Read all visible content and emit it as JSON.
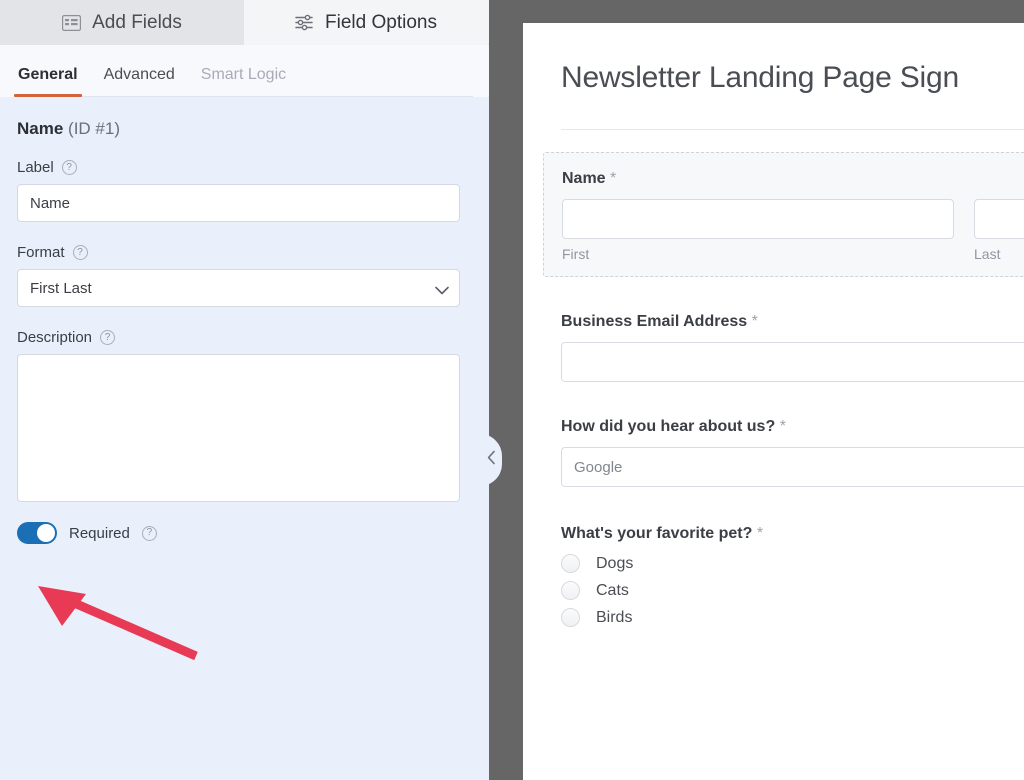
{
  "builder": {
    "primary_tabs": [
      {
        "label": "Add Fields",
        "icon": "list-fields-icon",
        "active": false
      },
      {
        "label": "Field Options",
        "icon": "sliders-icon",
        "active": true
      }
    ],
    "secondary_tabs": [
      {
        "label": "General",
        "state": "active"
      },
      {
        "label": "Advanced",
        "state": "normal"
      },
      {
        "label": "Smart Logic",
        "state": "disabled"
      }
    ],
    "field_heading": {
      "name": "Name",
      "id_text": "(ID #1)"
    },
    "options": {
      "label_label": "Label",
      "label_value": "Name",
      "format_label": "Format",
      "format_value": "First Last",
      "description_label": "Description",
      "description_value": "",
      "required_label": "Required",
      "required_on": true,
      "help_icon": "?"
    },
    "collapse_handle": {
      "icon": "chevron-left-icon"
    },
    "accent_color": "#d4633c",
    "toggle_on_color": "#1a6fb5"
  },
  "preview": {
    "form_title": "Newsletter Landing Page Sign",
    "fields": [
      {
        "label": "Name",
        "required_mark": "*",
        "type": "name",
        "selected": true,
        "sub": [
          {
            "value": "",
            "caption": "First"
          },
          {
            "value": "",
            "caption": "Last"
          }
        ]
      },
      {
        "label": "Business Email Address",
        "required_mark": "*",
        "type": "text",
        "value": ""
      },
      {
        "label": "How did you hear about us?",
        "required_mark": "*",
        "type": "select",
        "value": "Google"
      },
      {
        "label": "What's your favorite pet?",
        "required_mark": "*",
        "type": "radio",
        "choices": [
          "Dogs",
          "Cats",
          "Birds"
        ]
      }
    ]
  },
  "annotation": {
    "arrow_color": "#e83a55",
    "target": "required-toggle"
  }
}
